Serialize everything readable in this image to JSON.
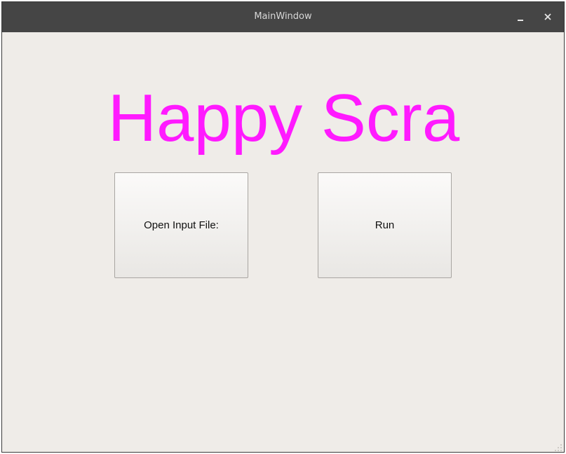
{
  "window": {
    "title": "MainWindow",
    "controls": {
      "minimize_icon": "minimize-icon",
      "close_icon": "close-icon"
    }
  },
  "main": {
    "heading": "Happy Scra",
    "heading_color": "#ff1aff",
    "open_button_label": "Open Input File:",
    "run_button_label": "Run"
  },
  "colors": {
    "titlebar": "#454545",
    "background": "#efece8"
  }
}
